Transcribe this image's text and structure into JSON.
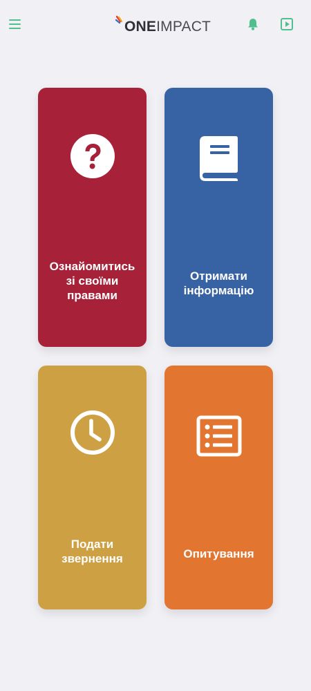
{
  "header": {
    "logo_bold": "ONE",
    "logo_light": "IMPACT",
    "accent_color": "#4fc08d"
  },
  "tiles": [
    {
      "label": "Ознайомитись\nзі своїми\nправами",
      "color": "#a72239",
      "icon": "question-circle-icon"
    },
    {
      "label": "Отримати\nінформацію",
      "color": "#3763a5",
      "icon": "book-icon"
    },
    {
      "label": "Подати\nзвернення",
      "color": "#cda143",
      "icon": "clock-icon"
    },
    {
      "label": "Опитування",
      "color": "#e27630",
      "icon": "list-icon"
    }
  ]
}
